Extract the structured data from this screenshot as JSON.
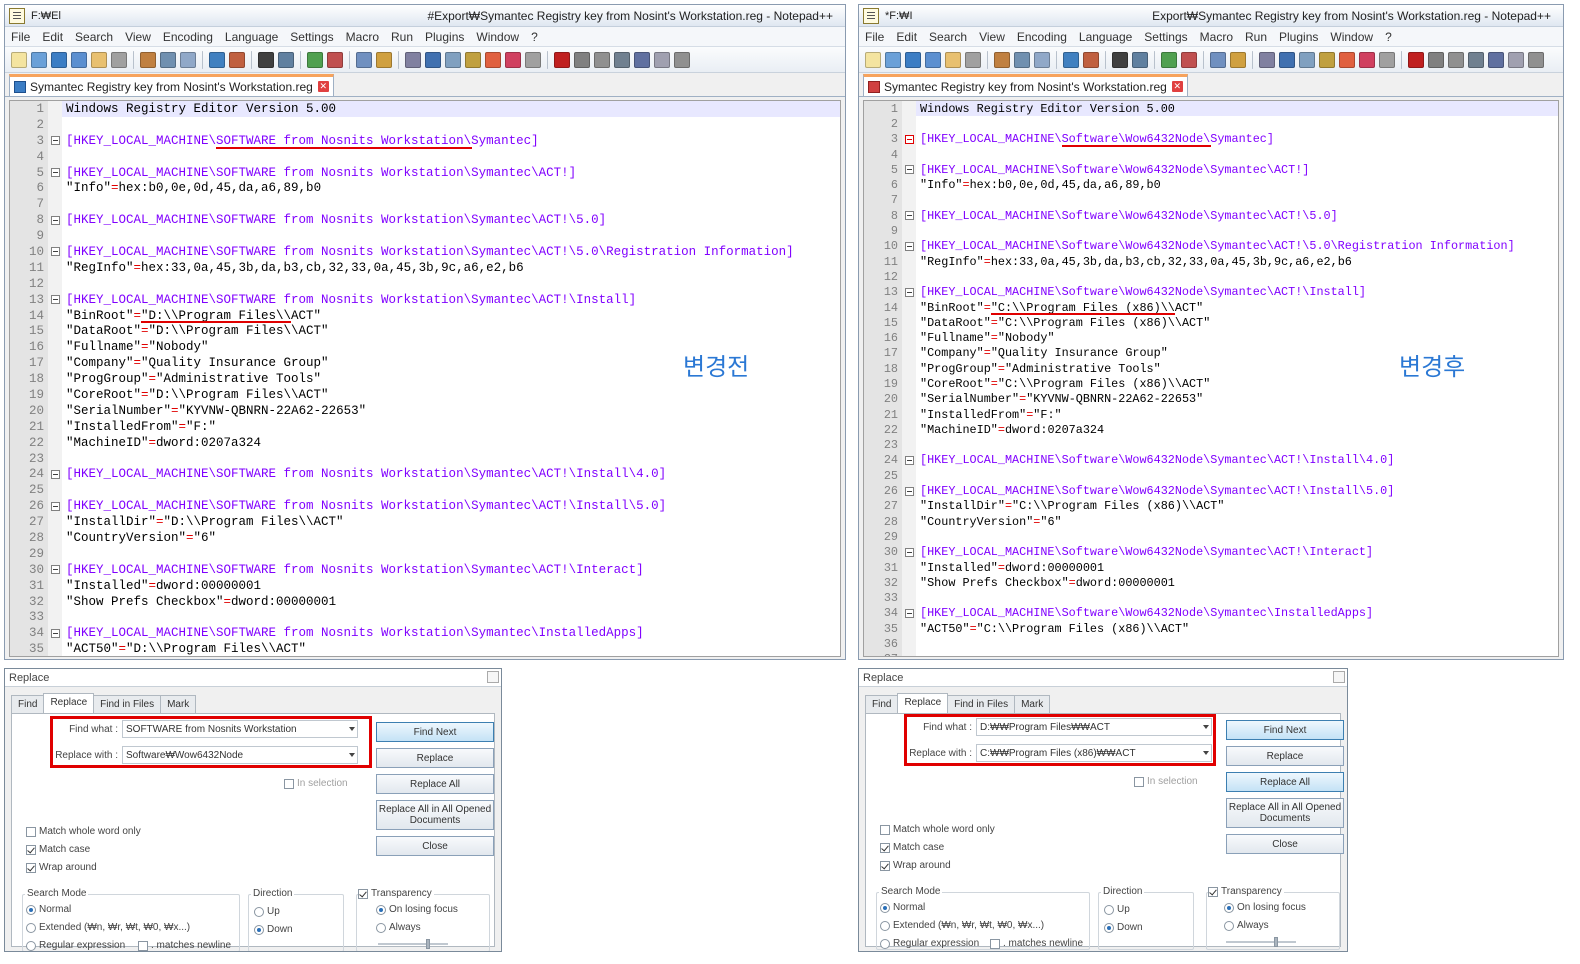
{
  "left": {
    "title_short": "F:₩El",
    "title": "#Export₩Symantec Registry key from Nosint's Workstation.reg - Notepad++",
    "tab_name": "Symantec Registry key from Nosint's Workstation.reg",
    "label": "변경전",
    "lines": [
      {
        "n": "1",
        "t": "plain",
        "text": "Windows Registry Editor Version 5.00"
      },
      {
        "n": "2",
        "t": "empty",
        "text": ""
      },
      {
        "n": "3",
        "t": "key",
        "text": "[HKEY_LOCAL_MACHINE\\SOFTWARE from Nosnits Workstation\\Symantec]"
      },
      {
        "n": "4",
        "t": "empty",
        "text": ""
      },
      {
        "n": "5",
        "t": "key",
        "text": "[HKEY_LOCAL_MACHINE\\SOFTWARE from Nosnits Workstation\\Symantec\\ACT!]"
      },
      {
        "n": "6",
        "t": "val",
        "k": "\"Info\"",
        "v": "hex:b0,0e,0d,45,da,a6,89,b0"
      },
      {
        "n": "7",
        "t": "empty",
        "text": ""
      },
      {
        "n": "8",
        "t": "key",
        "text": "[HKEY_LOCAL_MACHINE\\SOFTWARE from Nosnits Workstation\\Symantec\\ACT!\\5.0]"
      },
      {
        "n": "9",
        "t": "empty",
        "text": ""
      },
      {
        "n": "10",
        "t": "key",
        "text": "[HKEY_LOCAL_MACHINE\\SOFTWARE from Nosnits Workstation\\Symantec\\ACT!\\5.0\\Registration Information]"
      },
      {
        "n": "11",
        "t": "val",
        "k": "\"RegInfo\"",
        "v": "hex:33,0a,45,3b,da,b3,cb,32,33,0a,45,3b,9c,a6,e2,b6"
      },
      {
        "n": "12",
        "t": "empty",
        "text": ""
      },
      {
        "n": "13",
        "t": "key",
        "text": "[HKEY_LOCAL_MACHINE\\SOFTWARE from Nosnits Workstation\\Symantec\\ACT!\\Install]"
      },
      {
        "n": "14",
        "t": "val",
        "k": "\"BinRoot\"",
        "v": "\"D:\\\\Program Files\\\\ACT\""
      },
      {
        "n": "15",
        "t": "val",
        "k": "\"DataRoot\"",
        "v": "\"D:\\\\Program Files\\\\ACT\""
      },
      {
        "n": "16",
        "t": "val",
        "k": "\"Fullname\"",
        "v": "\"Nobody\""
      },
      {
        "n": "17",
        "t": "val",
        "k": "\"Company\"",
        "v": "\"Quality Insurance Group\""
      },
      {
        "n": "18",
        "t": "val",
        "k": "\"ProgGroup\"",
        "v": "\"Administrative Tools\""
      },
      {
        "n": "19",
        "t": "val",
        "k": "\"CoreRoot\"",
        "v": "\"D:\\\\Program Files\\\\ACT\""
      },
      {
        "n": "20",
        "t": "val",
        "k": "\"SerialNumber\"",
        "v": "\"KYVNW-QBNRN-22A62-22653\""
      },
      {
        "n": "21",
        "t": "val",
        "k": "\"InstalledFrom\"",
        "v": "\"F:\""
      },
      {
        "n": "22",
        "t": "val",
        "k": "\"MachineID\"",
        "v": "dword:0207a324"
      },
      {
        "n": "23",
        "t": "empty",
        "text": ""
      },
      {
        "n": "24",
        "t": "key",
        "text": "[HKEY_LOCAL_MACHINE\\SOFTWARE from Nosnits Workstation\\Symantec\\ACT!\\Install\\4.0]"
      },
      {
        "n": "25",
        "t": "empty",
        "text": ""
      },
      {
        "n": "26",
        "t": "key",
        "text": "[HKEY_LOCAL_MACHINE\\SOFTWARE from Nosnits Workstation\\Symantec\\ACT!\\Install\\5.0]"
      },
      {
        "n": "27",
        "t": "val",
        "k": "\"InstallDir\"",
        "v": "\"D:\\\\Program Files\\\\ACT\""
      },
      {
        "n": "28",
        "t": "val",
        "k": "\"CountryVersion\"",
        "v": "\"6\""
      },
      {
        "n": "29",
        "t": "empty",
        "text": ""
      },
      {
        "n": "30",
        "t": "key",
        "text": "[HKEY_LOCAL_MACHINE\\SOFTWARE from Nosnits Workstation\\Symantec\\ACT!\\Interact]"
      },
      {
        "n": "31",
        "t": "val",
        "k": "\"Installed\"",
        "v": "dword:00000001"
      },
      {
        "n": "32",
        "t": "val",
        "k": "\"Show Prefs Checkbox\"",
        "v": "dword:00000001"
      },
      {
        "n": "33",
        "t": "empty",
        "text": ""
      },
      {
        "n": "34",
        "t": "key",
        "text": "[HKEY_LOCAL_MACHINE\\SOFTWARE from Nosnits Workstation\\Symantec\\InstalledApps]"
      },
      {
        "n": "35",
        "t": "val",
        "k": "\"ACT50\"",
        "v": "\"D:\\\\Program Files\\\\ACT\""
      }
    ],
    "dialog": {
      "title": "Replace",
      "tabs": [
        "Find",
        "Replace",
        "Find in Files",
        "Mark"
      ],
      "find_label": "Find what :",
      "find_value": "SOFTWARE from Nosnits Workstation",
      "replace_label": "Replace with :",
      "replace_value": "Software₩Wow6432Node"
    }
  },
  "right": {
    "title_short": "*F:₩I",
    "title": "Export₩Symantec Registry key from Nosint's Workstation.reg - Notepad++",
    "tab_name": "Symantec Registry key from Nosint's Workstation.reg",
    "label": "변경후",
    "lines": [
      {
        "n": "1",
        "t": "plain",
        "text": "Windows Registry Editor Version 5.00"
      },
      {
        "n": "2",
        "t": "empty",
        "text": ""
      },
      {
        "n": "3",
        "t": "key",
        "text": "[HKEY_LOCAL_MACHINE\\Software\\Wow6432Node\\Symantec]"
      },
      {
        "n": "4",
        "t": "empty",
        "text": ""
      },
      {
        "n": "5",
        "t": "key",
        "text": "[HKEY_LOCAL_MACHINE\\Software\\Wow6432Node\\Symantec\\ACT!]"
      },
      {
        "n": "6",
        "t": "val",
        "k": "\"Info\"",
        "v": "hex:b0,0e,0d,45,da,a6,89,b0"
      },
      {
        "n": "7",
        "t": "empty",
        "text": ""
      },
      {
        "n": "8",
        "t": "key",
        "text": "[HKEY_LOCAL_MACHINE\\Software\\Wow6432Node\\Symantec\\ACT!\\5.0]"
      },
      {
        "n": "9",
        "t": "empty",
        "text": ""
      },
      {
        "n": "10",
        "t": "key",
        "text": "[HKEY_LOCAL_MACHINE\\Software\\Wow6432Node\\Symantec\\ACT!\\5.0\\Registration Information]"
      },
      {
        "n": "11",
        "t": "val",
        "k": "\"RegInfo\"",
        "v": "hex:33,0a,45,3b,da,b3,cb,32,33,0a,45,3b,9c,a6,e2,b6"
      },
      {
        "n": "12",
        "t": "empty",
        "text": ""
      },
      {
        "n": "13",
        "t": "key",
        "text": "[HKEY_LOCAL_MACHINE\\Software\\Wow6432Node\\Symantec\\ACT!\\Install]"
      },
      {
        "n": "14",
        "t": "val",
        "k": "\"BinRoot\"",
        "v": "\"C:\\\\Program Files (x86)\\\\ACT\""
      },
      {
        "n": "15",
        "t": "val",
        "k": "\"DataRoot\"",
        "v": "\"C:\\\\Program Files (x86)\\\\ACT\""
      },
      {
        "n": "16",
        "t": "val",
        "k": "\"Fullname\"",
        "v": "\"Nobody\""
      },
      {
        "n": "17",
        "t": "val",
        "k": "\"Company\"",
        "v": "\"Quality Insurance Group\""
      },
      {
        "n": "18",
        "t": "val",
        "k": "\"ProgGroup\"",
        "v": "\"Administrative Tools\""
      },
      {
        "n": "19",
        "t": "val",
        "k": "\"CoreRoot\"",
        "v": "\"C:\\\\Program Files (x86)\\\\ACT\""
      },
      {
        "n": "20",
        "t": "val",
        "k": "\"SerialNumber\"",
        "v": "\"KYVNW-QBNRN-22A62-22653\""
      },
      {
        "n": "21",
        "t": "val",
        "k": "\"InstalledFrom\"",
        "v": "\"F:\""
      },
      {
        "n": "22",
        "t": "val",
        "k": "\"MachineID\"",
        "v": "dword:0207a324"
      },
      {
        "n": "23",
        "t": "empty",
        "text": ""
      },
      {
        "n": "24",
        "t": "key",
        "text": "[HKEY_LOCAL_MACHINE\\Software\\Wow6432Node\\Symantec\\ACT!\\Install\\4.0]"
      },
      {
        "n": "25",
        "t": "empty",
        "text": ""
      },
      {
        "n": "26",
        "t": "key",
        "text": "[HKEY_LOCAL_MACHINE\\Software\\Wow6432Node\\Symantec\\ACT!\\Install\\5.0]"
      },
      {
        "n": "27",
        "t": "val",
        "k": "\"InstallDir\"",
        "v": "\"C:\\\\Program Files (x86)\\\\ACT\""
      },
      {
        "n": "28",
        "t": "val",
        "k": "\"CountryVersion\"",
        "v": "\"6\""
      },
      {
        "n": "29",
        "t": "empty",
        "text": ""
      },
      {
        "n": "30",
        "t": "key",
        "text": "[HKEY_LOCAL_MACHINE\\Software\\Wow6432Node\\Symantec\\ACT!\\Interact]"
      },
      {
        "n": "31",
        "t": "val",
        "k": "\"Installed\"",
        "v": "dword:00000001"
      },
      {
        "n": "32",
        "t": "val",
        "k": "\"Show Prefs Checkbox\"",
        "v": "dword:00000001"
      },
      {
        "n": "33",
        "t": "empty",
        "text": ""
      },
      {
        "n": "34",
        "t": "key",
        "text": "[HKEY_LOCAL_MACHINE\\Software\\Wow6432Node\\Symantec\\InstalledApps]"
      },
      {
        "n": "35",
        "t": "val",
        "k": "\"ACT50\"",
        "v": "\"C:\\\\Program Files (x86)\\\\ACT\""
      },
      {
        "n": "36",
        "t": "empty",
        "text": ""
      },
      {
        "n": "37",
        "t": "empty",
        "text": ""
      }
    ],
    "dialog": {
      "title": "Replace",
      "tabs": [
        "Find",
        "Replace",
        "Find in Files",
        "Mark"
      ],
      "find_label": "Find what :",
      "find_value": "D:₩₩Program Files₩₩ACT",
      "replace_label": "Replace with :",
      "replace_value": "C:₩₩Program Files (x86)₩₩ACT"
    }
  },
  "menu": [
    "File",
    "Edit",
    "Search",
    "View",
    "Encoding",
    "Language",
    "Settings",
    "Macro",
    "Run",
    "Plugins",
    "Window",
    "?"
  ],
  "dialog_common": {
    "btn_find_next": "Find Next",
    "btn_replace": "Replace",
    "btn_replace_all": "Replace All",
    "btn_replace_all_opened": "Replace All in All Opened Documents",
    "btn_close": "Close",
    "in_selection": "In selection",
    "match_whole_word": "Match whole word only",
    "match_case": "Match case",
    "wrap_around": "Wrap around",
    "search_mode": "Search Mode",
    "mode_normal": "Normal",
    "mode_extended": "Extended (₩n, ₩r, ₩t, ₩0, ₩x...)",
    "mode_regex": "Regular expression",
    "matches_newline": ". matches newline",
    "direction": "Direction",
    "dir_up": "Up",
    "dir_down": "Down",
    "transparency": "Transparency",
    "on_losing_focus": "On losing focus",
    "always": "Always"
  },
  "colors": {
    "key": "#8000ff",
    "operator": "#e00000",
    "highlight": "#e00000",
    "label": "#2b78d4"
  }
}
